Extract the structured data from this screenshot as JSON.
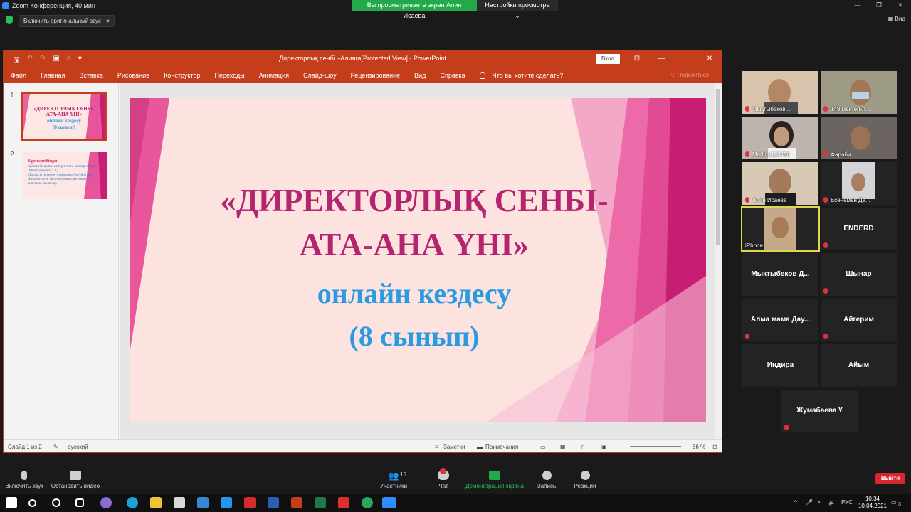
{
  "zoom": {
    "window_title": "Zoom Конференция, 40 мин",
    "share_banner": "Вы просматриваете экран Алия Исаева",
    "view_settings": "Настройки просмотра ⌄",
    "original_sound": "Включить оригинальный звук",
    "view_label": "Вид"
  },
  "ppt": {
    "title": "Директорлық сенбі –Алияга[Protected View]  -  PowerPoint",
    "login": "Вход",
    "ribbon_tabs": [
      "Файл",
      "Главная",
      "Вставка",
      "Рисование",
      "Конструктор",
      "Переходы",
      "Анимация",
      "Слайд-шоу",
      "Рецензирование",
      "Вид",
      "Справка"
    ],
    "tell_me": "Что вы хотите сделать?",
    "share": "Поделиться",
    "thumbnails": [
      {
        "num": "1",
        "line1": "«ДИРЕКТОРЛЫҚ СЕНБІ-",
        "line2": "АТА-АНА ҮНІ»",
        "line3": "онлайн кездесу",
        "line4": "(8 сынып)"
      },
      {
        "num": "2",
        "heading": "Күн тәртібінде:",
        "items": [
          "Қазақстан қалқы интернет ата-аналар ойлары (Мықтыбекова Д.Т.)",
          "«Кауіпсіз интернет» (меңдіре Ақтуйім Ж.С.)",
          "Шешімтелген мәселе (сынып жетекшісі)",
          "анкетасы сынаклар"
        ]
      }
    ],
    "slide": {
      "line1": "«ДИРЕКТОРЛЫҚ СЕНБІ-",
      "line2": "АТА-АНА ҮНІ»",
      "line3": "онлайн кездесу",
      "line4": "(8 сынып)"
    },
    "status": {
      "slide_of": "Слайд 1 из 2",
      "language": "русский",
      "notes": "Заметки",
      "comments": "Примечания",
      "zoom": "86 %"
    }
  },
  "participants": [
    {
      "name": "Мықтыбеков...",
      "video": true,
      "muted": true
    },
    {
      "name": "148 мектеп-л...",
      "video": true,
      "muted": true
    },
    {
      "name": "Madina123456",
      "video": true,
      "muted": true
    },
    {
      "name": "Фараби",
      "video": true,
      "muted": true
    },
    {
      "name": "Алия Исаева",
      "video": true,
      "muted": true
    },
    {
      "name": "Есенаман Да...",
      "video": true,
      "muted": true
    },
    {
      "name": "iPhone",
      "video": true,
      "muted": false,
      "active": true
    },
    {
      "name": "ENDERD",
      "video": false,
      "muted": true
    },
    {
      "name": "Мыктыбеков  Д...",
      "video": false,
      "muted": false
    },
    {
      "name": "Шынар",
      "video": false,
      "muted": true
    },
    {
      "name": "Алма мама Дау...",
      "video": false,
      "muted": true
    },
    {
      "name": "Айгерим",
      "video": false,
      "muted": true
    },
    {
      "name": "Индира",
      "video": false,
      "muted": false
    },
    {
      "name": "Айым",
      "video": false,
      "muted": false
    },
    {
      "name": "Жумабаева Ұ",
      "video": false,
      "muted": true
    }
  ],
  "toolbar": {
    "unmute": "Включить звук",
    "start_video": "Остановить видео",
    "participants_label": "Участники",
    "participants_count": "15",
    "chat": "Чат",
    "chat_badge": "1",
    "share": "Демонстрация экрана",
    "record": "Запись",
    "reactions": "Реакции",
    "leave": "Выйти"
  },
  "taskbar": {
    "lang": "РУС",
    "time": "10:34",
    "date": "10.04.2021",
    "notif": "3"
  },
  "colors": {
    "ppt_red": "#c43e1c",
    "slide_magenta": "#b5246e",
    "slide_blue": "#2a9be0",
    "zoom_green": "#22a94a",
    "leave_red": "#d9262f"
  }
}
